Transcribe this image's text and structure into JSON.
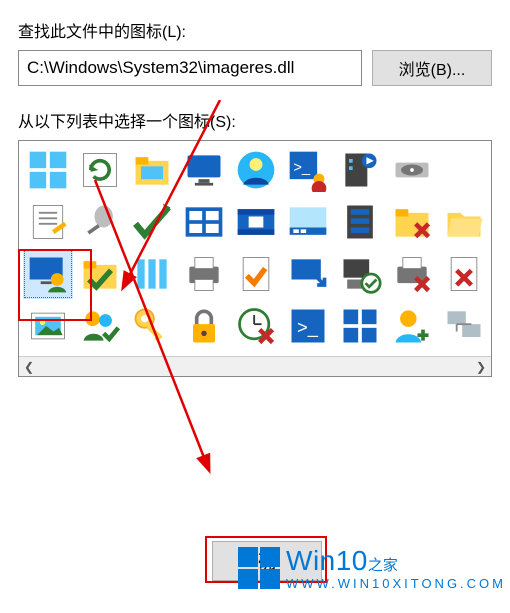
{
  "labels": {
    "lookIn": "查找此文件中的图标(L):",
    "selectFrom": "从以下列表中选择一个图标(S):"
  },
  "path": {
    "value": "C:\\Windows\\System32\\imageres.dll"
  },
  "buttons": {
    "browse": "浏览(B)...",
    "ok": "确"
  },
  "watermark": {
    "brand": "Win10",
    "sub": "之家",
    "url": "WWW.WIN10XITONG.COM"
  },
  "scroll": {
    "left": "❮",
    "right": "❯"
  },
  "icons": [
    "apps",
    "refresh",
    "folder-explorer",
    "display",
    "user-circle",
    "ps-user",
    "server-media",
    "drive",
    "blank",
    "notepad",
    "pin",
    "check-arrow",
    "windows-tile",
    "filmstrip",
    "taskbar",
    "server",
    "folder-x",
    "folder-open",
    "monitor-user",
    "folder-check",
    "library",
    "printer",
    "file-check",
    "monitor-arrow",
    "pc-check",
    "printer-x",
    "file-x",
    "picture",
    "users-check",
    "key",
    "lock",
    "clock-x",
    "ps-tile",
    "tiles",
    "user-plus",
    "network"
  ],
  "selectedIndex": 18
}
